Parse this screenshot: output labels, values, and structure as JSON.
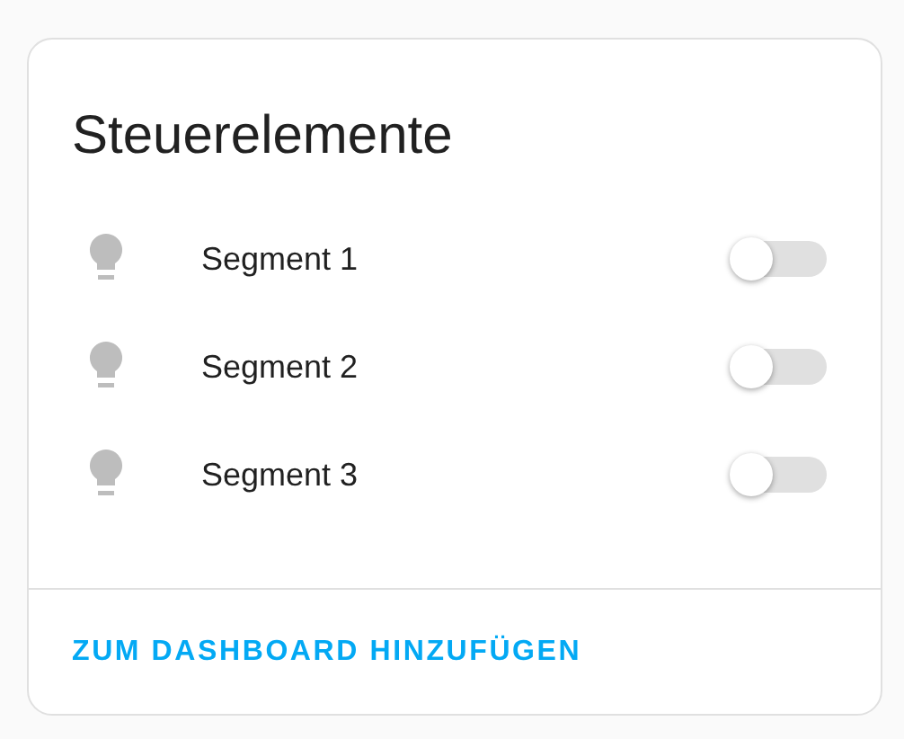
{
  "card": {
    "title": "Steuerelemente",
    "items": [
      {
        "label": "Segment 1",
        "on": false
      },
      {
        "label": "Segment 2",
        "on": false
      },
      {
        "label": "Segment 3",
        "on": false
      }
    ],
    "action": "ZUM DASHBOARD HINZUFÜGEN"
  }
}
